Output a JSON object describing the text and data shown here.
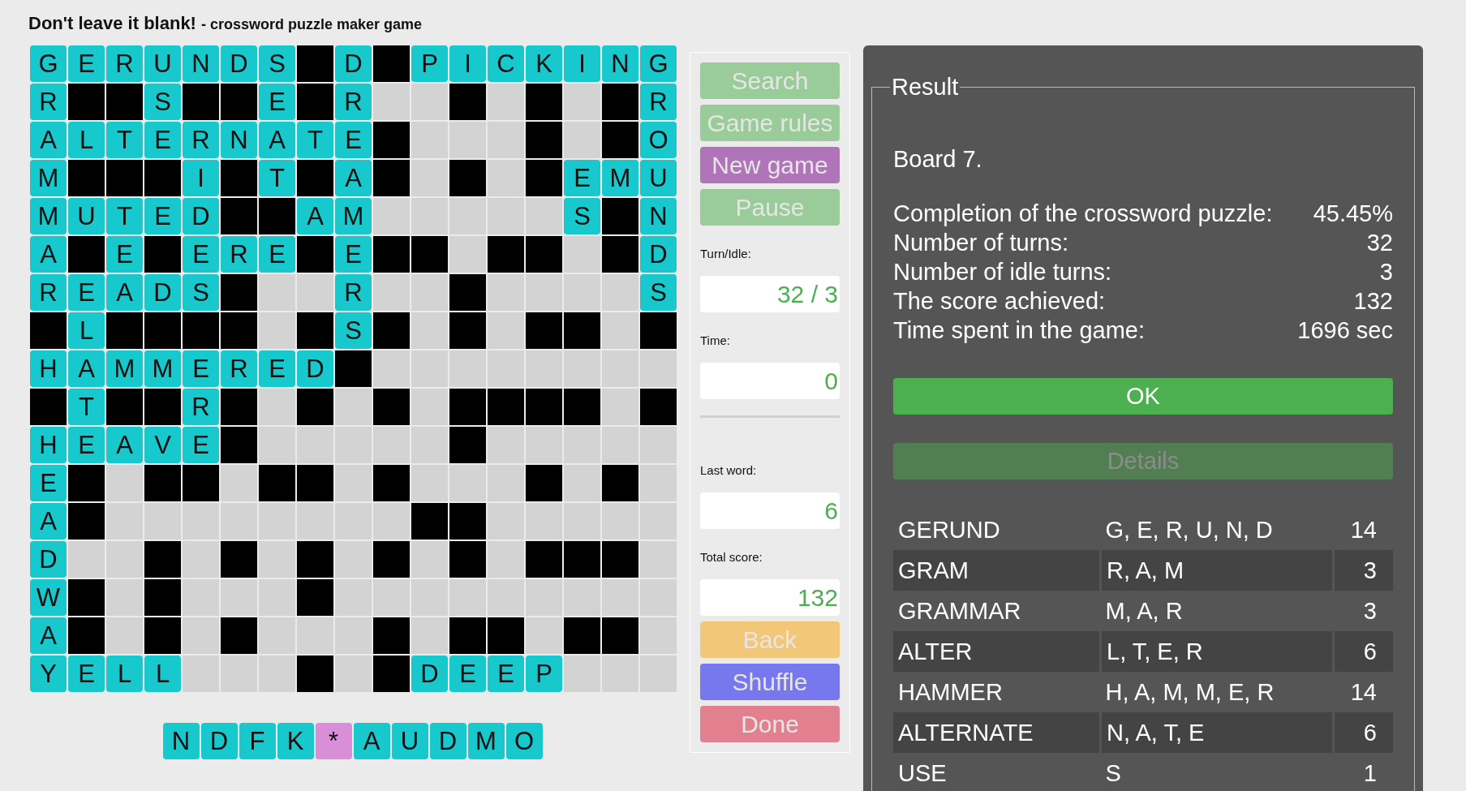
{
  "header": {
    "title": "Don't leave it blank!",
    "subtitle": "- crossword puzzle maker game"
  },
  "board": {
    "rows": [
      [
        {
          "kind": "letter",
          "letter": "G"
        },
        {
          "kind": "letter",
          "letter": "E"
        },
        {
          "kind": "letter",
          "letter": "R"
        },
        {
          "kind": "letter",
          "letter": "U"
        },
        {
          "kind": "letter",
          "letter": "N"
        },
        {
          "kind": "letter",
          "letter": "D"
        },
        {
          "kind": "letter",
          "letter": "S"
        },
        {
          "kind": "block"
        },
        {
          "kind": "letter",
          "letter": "D"
        },
        {
          "kind": "block"
        },
        {
          "kind": "letter",
          "letter": "P"
        },
        {
          "kind": "letter",
          "letter": "I"
        },
        {
          "kind": "letter",
          "letter": "C"
        },
        {
          "kind": "letter",
          "letter": "K"
        },
        {
          "kind": "letter",
          "letter": "I"
        },
        {
          "kind": "letter",
          "letter": "N"
        },
        {
          "kind": "letter",
          "letter": "G"
        }
      ],
      [
        {
          "kind": "letter",
          "letter": "R"
        },
        {
          "kind": "block"
        },
        {
          "kind": "block"
        },
        {
          "kind": "letter",
          "letter": "S"
        },
        {
          "kind": "block"
        },
        {
          "kind": "block"
        },
        {
          "kind": "letter",
          "letter": "E"
        },
        {
          "kind": "block"
        },
        {
          "kind": "letter",
          "letter": "R"
        },
        {
          "kind": "empty"
        },
        {
          "kind": "empty"
        },
        {
          "kind": "block"
        },
        {
          "kind": "empty"
        },
        {
          "kind": "block"
        },
        {
          "kind": "empty"
        },
        {
          "kind": "block"
        },
        {
          "kind": "letter",
          "letter": "R"
        }
      ],
      [
        {
          "kind": "letter",
          "letter": "A"
        },
        {
          "kind": "letter",
          "letter": "L"
        },
        {
          "kind": "letter",
          "letter": "T"
        },
        {
          "kind": "letter",
          "letter": "E"
        },
        {
          "kind": "letter",
          "letter": "R"
        },
        {
          "kind": "letter",
          "letter": "N"
        },
        {
          "kind": "letter",
          "letter": "A"
        },
        {
          "kind": "letter",
          "letter": "T"
        },
        {
          "kind": "letter",
          "letter": "E"
        },
        {
          "kind": "block"
        },
        {
          "kind": "empty"
        },
        {
          "kind": "empty"
        },
        {
          "kind": "empty"
        },
        {
          "kind": "block"
        },
        {
          "kind": "empty"
        },
        {
          "kind": "block"
        },
        {
          "kind": "letter",
          "letter": "O"
        }
      ],
      [
        {
          "kind": "letter",
          "letter": "M"
        },
        {
          "kind": "block"
        },
        {
          "kind": "block"
        },
        {
          "kind": "block"
        },
        {
          "kind": "letter",
          "letter": "I"
        },
        {
          "kind": "block"
        },
        {
          "kind": "letter",
          "letter": "T"
        },
        {
          "kind": "block"
        },
        {
          "kind": "letter",
          "letter": "A"
        },
        {
          "kind": "block"
        },
        {
          "kind": "empty"
        },
        {
          "kind": "block"
        },
        {
          "kind": "empty"
        },
        {
          "kind": "block"
        },
        {
          "kind": "letter",
          "letter": "E"
        },
        {
          "kind": "letter",
          "letter": "M"
        },
        {
          "kind": "letter",
          "letter": "U"
        }
      ],
      [
        {
          "kind": "letter",
          "letter": "M"
        },
        {
          "kind": "letter",
          "letter": "U"
        },
        {
          "kind": "letter",
          "letter": "T"
        },
        {
          "kind": "letter",
          "letter": "E"
        },
        {
          "kind": "letter",
          "letter": "D"
        },
        {
          "kind": "block"
        },
        {
          "kind": "block"
        },
        {
          "kind": "letter",
          "letter": "A"
        },
        {
          "kind": "letter",
          "letter": "M"
        },
        {
          "kind": "empty"
        },
        {
          "kind": "empty"
        },
        {
          "kind": "empty"
        },
        {
          "kind": "empty"
        },
        {
          "kind": "empty"
        },
        {
          "kind": "letter",
          "letter": "S"
        },
        {
          "kind": "block"
        },
        {
          "kind": "letter",
          "letter": "N"
        }
      ],
      [
        {
          "kind": "letter",
          "letter": "A"
        },
        {
          "kind": "block"
        },
        {
          "kind": "letter",
          "letter": "E"
        },
        {
          "kind": "block"
        },
        {
          "kind": "letter",
          "letter": "E"
        },
        {
          "kind": "letter",
          "letter": "R"
        },
        {
          "kind": "letter",
          "letter": "E"
        },
        {
          "kind": "block"
        },
        {
          "kind": "letter",
          "letter": "E"
        },
        {
          "kind": "block"
        },
        {
          "kind": "block"
        },
        {
          "kind": "empty"
        },
        {
          "kind": "block"
        },
        {
          "kind": "block"
        },
        {
          "kind": "empty"
        },
        {
          "kind": "block"
        },
        {
          "kind": "letter",
          "letter": "D"
        }
      ],
      [
        {
          "kind": "letter",
          "letter": "R"
        },
        {
          "kind": "letter",
          "letter": "E"
        },
        {
          "kind": "letter",
          "letter": "A"
        },
        {
          "kind": "letter",
          "letter": "D"
        },
        {
          "kind": "letter",
          "letter": "S"
        },
        {
          "kind": "block"
        },
        {
          "kind": "empty"
        },
        {
          "kind": "empty"
        },
        {
          "kind": "letter",
          "letter": "R"
        },
        {
          "kind": "empty"
        },
        {
          "kind": "empty"
        },
        {
          "kind": "block"
        },
        {
          "kind": "empty"
        },
        {
          "kind": "empty"
        },
        {
          "kind": "empty"
        },
        {
          "kind": "empty"
        },
        {
          "kind": "letter",
          "letter": "S"
        }
      ],
      [
        {
          "kind": "block"
        },
        {
          "kind": "letter",
          "letter": "L"
        },
        {
          "kind": "block"
        },
        {
          "kind": "block"
        },
        {
          "kind": "block"
        },
        {
          "kind": "block"
        },
        {
          "kind": "empty"
        },
        {
          "kind": "block"
        },
        {
          "kind": "letter",
          "letter": "S"
        },
        {
          "kind": "block"
        },
        {
          "kind": "empty"
        },
        {
          "kind": "block"
        },
        {
          "kind": "empty"
        },
        {
          "kind": "block"
        },
        {
          "kind": "block"
        },
        {
          "kind": "empty"
        },
        {
          "kind": "block"
        }
      ],
      [
        {
          "kind": "letter",
          "letter": "H"
        },
        {
          "kind": "letter",
          "letter": "A"
        },
        {
          "kind": "letter",
          "letter": "M"
        },
        {
          "kind": "letter",
          "letter": "M"
        },
        {
          "kind": "letter",
          "letter": "E"
        },
        {
          "kind": "letter",
          "letter": "R"
        },
        {
          "kind": "letter",
          "letter": "E"
        },
        {
          "kind": "letter",
          "letter": "D"
        },
        {
          "kind": "block"
        },
        {
          "kind": "empty"
        },
        {
          "kind": "empty"
        },
        {
          "kind": "empty"
        },
        {
          "kind": "empty"
        },
        {
          "kind": "empty"
        },
        {
          "kind": "empty"
        },
        {
          "kind": "empty"
        },
        {
          "kind": "empty"
        }
      ],
      [
        {
          "kind": "block"
        },
        {
          "kind": "letter",
          "letter": "T"
        },
        {
          "kind": "block"
        },
        {
          "kind": "block"
        },
        {
          "kind": "letter",
          "letter": "R"
        },
        {
          "kind": "block"
        },
        {
          "kind": "empty"
        },
        {
          "kind": "block"
        },
        {
          "kind": "empty"
        },
        {
          "kind": "block"
        },
        {
          "kind": "empty"
        },
        {
          "kind": "block"
        },
        {
          "kind": "block"
        },
        {
          "kind": "block"
        },
        {
          "kind": "block"
        },
        {
          "kind": "empty"
        },
        {
          "kind": "block"
        }
      ],
      [
        {
          "kind": "letter",
          "letter": "H"
        },
        {
          "kind": "letter",
          "letter": "E"
        },
        {
          "kind": "letter",
          "letter": "A"
        },
        {
          "kind": "letter",
          "letter": "V"
        },
        {
          "kind": "letter",
          "letter": "E"
        },
        {
          "kind": "block"
        },
        {
          "kind": "empty"
        },
        {
          "kind": "empty"
        },
        {
          "kind": "empty"
        },
        {
          "kind": "empty"
        },
        {
          "kind": "empty"
        },
        {
          "kind": "block"
        },
        {
          "kind": "empty"
        },
        {
          "kind": "empty"
        },
        {
          "kind": "empty"
        },
        {
          "kind": "empty"
        },
        {
          "kind": "empty"
        }
      ],
      [
        {
          "kind": "letter",
          "letter": "E"
        },
        {
          "kind": "block"
        },
        {
          "kind": "empty"
        },
        {
          "kind": "block"
        },
        {
          "kind": "block"
        },
        {
          "kind": "empty"
        },
        {
          "kind": "block"
        },
        {
          "kind": "block"
        },
        {
          "kind": "empty"
        },
        {
          "kind": "block"
        },
        {
          "kind": "empty"
        },
        {
          "kind": "empty"
        },
        {
          "kind": "empty"
        },
        {
          "kind": "block"
        },
        {
          "kind": "empty"
        },
        {
          "kind": "block"
        },
        {
          "kind": "empty"
        }
      ],
      [
        {
          "kind": "letter",
          "letter": "A"
        },
        {
          "kind": "block"
        },
        {
          "kind": "empty"
        },
        {
          "kind": "empty"
        },
        {
          "kind": "empty"
        },
        {
          "kind": "empty"
        },
        {
          "kind": "empty"
        },
        {
          "kind": "empty"
        },
        {
          "kind": "empty"
        },
        {
          "kind": "empty"
        },
        {
          "kind": "block"
        },
        {
          "kind": "block"
        },
        {
          "kind": "empty"
        },
        {
          "kind": "empty"
        },
        {
          "kind": "empty"
        },
        {
          "kind": "empty"
        },
        {
          "kind": "empty"
        }
      ],
      [
        {
          "kind": "letter",
          "letter": "D"
        },
        {
          "kind": "empty"
        },
        {
          "kind": "empty"
        },
        {
          "kind": "block"
        },
        {
          "kind": "empty"
        },
        {
          "kind": "block"
        },
        {
          "kind": "empty"
        },
        {
          "kind": "block"
        },
        {
          "kind": "empty"
        },
        {
          "kind": "block"
        },
        {
          "kind": "empty"
        },
        {
          "kind": "block"
        },
        {
          "kind": "empty"
        },
        {
          "kind": "block"
        },
        {
          "kind": "block"
        },
        {
          "kind": "block"
        },
        {
          "kind": "empty"
        }
      ],
      [
        {
          "kind": "letter",
          "letter": "W"
        },
        {
          "kind": "block"
        },
        {
          "kind": "empty"
        },
        {
          "kind": "block"
        },
        {
          "kind": "empty"
        },
        {
          "kind": "empty"
        },
        {
          "kind": "empty"
        },
        {
          "kind": "block"
        },
        {
          "kind": "empty"
        },
        {
          "kind": "empty"
        },
        {
          "kind": "empty"
        },
        {
          "kind": "empty"
        },
        {
          "kind": "empty"
        },
        {
          "kind": "empty"
        },
        {
          "kind": "empty"
        },
        {
          "kind": "empty"
        },
        {
          "kind": "empty"
        }
      ],
      [
        {
          "kind": "letter",
          "letter": "A"
        },
        {
          "kind": "block"
        },
        {
          "kind": "empty"
        },
        {
          "kind": "block"
        },
        {
          "kind": "empty"
        },
        {
          "kind": "block"
        },
        {
          "kind": "empty"
        },
        {
          "kind": "empty"
        },
        {
          "kind": "empty"
        },
        {
          "kind": "block"
        },
        {
          "kind": "empty"
        },
        {
          "kind": "block"
        },
        {
          "kind": "block"
        },
        {
          "kind": "empty"
        },
        {
          "kind": "block"
        },
        {
          "kind": "block"
        },
        {
          "kind": "empty"
        }
      ],
      [
        {
          "kind": "letter",
          "letter": "Y"
        },
        {
          "kind": "letter",
          "letter": "E"
        },
        {
          "kind": "letter",
          "letter": "L"
        },
        {
          "kind": "letter",
          "letter": "L"
        },
        {
          "kind": "empty"
        },
        {
          "kind": "empty"
        },
        {
          "kind": "empty"
        },
        {
          "kind": "block"
        },
        {
          "kind": "empty"
        },
        {
          "kind": "block"
        },
        {
          "kind": "letter",
          "letter": "D"
        },
        {
          "kind": "letter",
          "letter": "E"
        },
        {
          "kind": "letter",
          "letter": "E"
        },
        {
          "kind": "letter",
          "letter": "P"
        },
        {
          "kind": "empty"
        },
        {
          "kind": "empty"
        },
        {
          "kind": "empty"
        }
      ]
    ]
  },
  "rack": [
    {
      "letter": "N",
      "kind": "letter"
    },
    {
      "letter": "D",
      "kind": "letter"
    },
    {
      "letter": "F",
      "kind": "letter"
    },
    {
      "letter": "K",
      "kind": "letter"
    },
    {
      "letter": "*",
      "kind": "joker"
    },
    {
      "letter": "A",
      "kind": "letter"
    },
    {
      "letter": "U",
      "kind": "letter"
    },
    {
      "letter": "D",
      "kind": "letter"
    },
    {
      "letter": "M",
      "kind": "letter"
    },
    {
      "letter": "O",
      "kind": "letter"
    }
  ],
  "side_panel": {
    "items": [
      {
        "kind": "button",
        "label": "Search",
        "color": "#99cc99"
      },
      {
        "kind": "button",
        "label": "Game rules",
        "color": "#99cc99"
      },
      {
        "kind": "button",
        "label": "New game",
        "color": "#b074b8"
      },
      {
        "kind": "button",
        "label": "Pause",
        "color": "#99cc99"
      },
      {
        "kind": "field",
        "label": "Turn/Idle:",
        "value": "32 / 3"
      },
      {
        "kind": "field",
        "label": "Time:",
        "value": "0"
      },
      {
        "kind": "divider"
      },
      {
        "kind": "field",
        "label": "Last word:",
        "value": "6"
      },
      {
        "kind": "field",
        "label": "Total score:",
        "value": "132"
      },
      {
        "kind": "button",
        "label": "Back",
        "color": "#f2c878"
      },
      {
        "kind": "button",
        "label": "Shuffle",
        "color": "#7878ee"
      },
      {
        "kind": "button",
        "label": "Done",
        "color": "#e28090"
      }
    ]
  },
  "result": {
    "legend": "Result",
    "board": "Board 7.",
    "stats": [
      {
        "label": "Completion of the crossword puzzle:",
        "value": "45.45%"
      },
      {
        "label": "Number of turns:",
        "value": "32"
      },
      {
        "label": "Number of idle turns:",
        "value": "3"
      },
      {
        "label": "The score achieved:",
        "value": "132"
      },
      {
        "label": "Time spent in the game:",
        "value": "1696 sec"
      }
    ],
    "buttons": [
      {
        "label": "OK",
        "disabled": false
      },
      {
        "label": "Details",
        "disabled": true
      }
    ],
    "words": [
      {
        "word": "GERUND",
        "letters": "G, E, R, U, N, D",
        "score": "14"
      },
      {
        "word": "GRAM",
        "letters": "R, A, M",
        "score": "3"
      },
      {
        "word": "GRAMMAR",
        "letters": "M, A, R",
        "score": "3"
      },
      {
        "word": "ALTER",
        "letters": "L, T, E, R",
        "score": "6"
      },
      {
        "word": "HAMMER",
        "letters": "H, A, M, M, E, R",
        "score": "14"
      },
      {
        "word": "ALTERNATE",
        "letters": "N, A, T, E",
        "score": "6"
      },
      {
        "word": "USE",
        "letters": "S",
        "score": "1"
      }
    ]
  }
}
